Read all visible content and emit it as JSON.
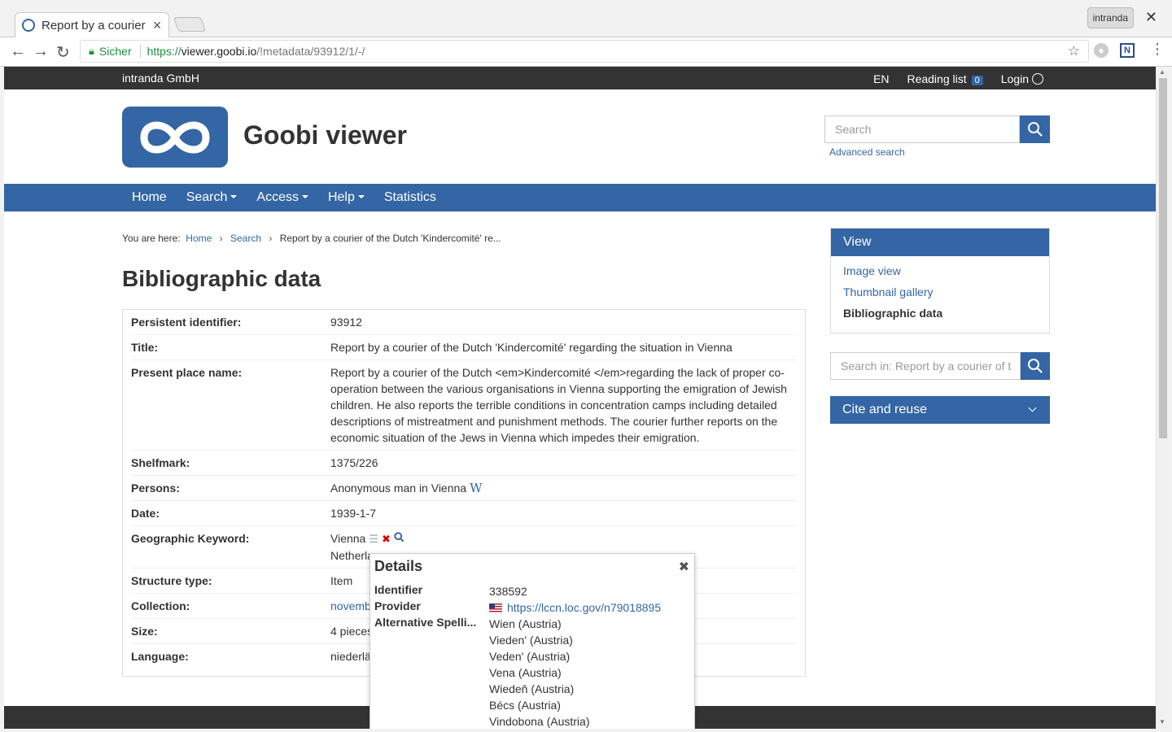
{
  "browser": {
    "tab_title": "Report by a courier of",
    "profile": "intranda",
    "secure_label": "Sicher",
    "url_scheme": "https://",
    "url_host": "viewer.goobi.io",
    "url_path": "/!metadata/93912/1/-/"
  },
  "topbar": {
    "brand": "intranda GmbH",
    "lang": "EN",
    "reading_list": "Reading list",
    "reading_count": "0",
    "login": "Login"
  },
  "header": {
    "site_name": "Goobi viewer",
    "search_placeholder": "Search",
    "advanced_search": "Advanced search"
  },
  "nav": {
    "items": [
      "Home",
      "Search",
      "Access",
      "Help",
      "Statistics"
    ]
  },
  "breadcrumb": {
    "prefix": "You are here:",
    "home": "Home",
    "search": "Search",
    "current": "Report by a courier of the Dutch 'Kindercomité' re..."
  },
  "main": {
    "title": "Bibliographic data",
    "rows": [
      {
        "key": "Persistent identifier:",
        "value": "93912"
      },
      {
        "key": "Title:",
        "value": "Report by a courier of the Dutch 'Kindercomité' regarding the situation in Vienna"
      },
      {
        "key": "Present place name:",
        "value": "Report by a courier of the Dutch <em>Kindercomité </em>regarding the lack of proper co-operation between the various organisations in Vienna supporting the emigration of Jewish children. He also reports the terrible conditions in concentration camps including detailed descriptions of mistreatment and punishment methods. The courier further reports on the economic situation of the Jews in Vienna which impedes their emigration."
      },
      {
        "key": "Shelfmark:",
        "value": "1375/226"
      },
      {
        "key": "Persons:",
        "value": "Anonymous man in Vienna"
      },
      {
        "key": "Date:",
        "value": "1939-1-7"
      },
      {
        "key": "Geographic Keyword:",
        "value": "Vienna",
        "value2": "Netherla"
      },
      {
        "key": "Structure type:",
        "value": "Item"
      },
      {
        "key": "Collection:",
        "value": "novemb"
      },
      {
        "key": "Size:",
        "value": "4 pieces"
      },
      {
        "key": "Language:",
        "value": "niederlä"
      }
    ],
    "wiki_glyph": "W"
  },
  "sidebar": {
    "view_title": "View",
    "image_view": "Image view",
    "thumbnail_gallery": "Thumbnail gallery",
    "bibliographic_data": "Bibliographic data",
    "search_placeholder": "Search in: Report by a courier of t",
    "cite_title": "Cite and reuse"
  },
  "popover": {
    "title": "Details",
    "identifier_label": "Identifier",
    "identifier_value": "338592",
    "provider_label": "Provider",
    "provider_value": "https://lccn.loc.gov/n79018895",
    "alt_label": "Alternative Spelli...",
    "alt_values": [
      "Wien (Austria)",
      "Vieden' (Austria)",
      "Veden' (Austria)",
      "Vena (Austria)",
      "Wiedeň (Austria)",
      "Bécs (Austria)",
      "Vindobona (Austria)"
    ]
  },
  "colors": {
    "accent": "#3465a4",
    "topbar": "#333333"
  }
}
